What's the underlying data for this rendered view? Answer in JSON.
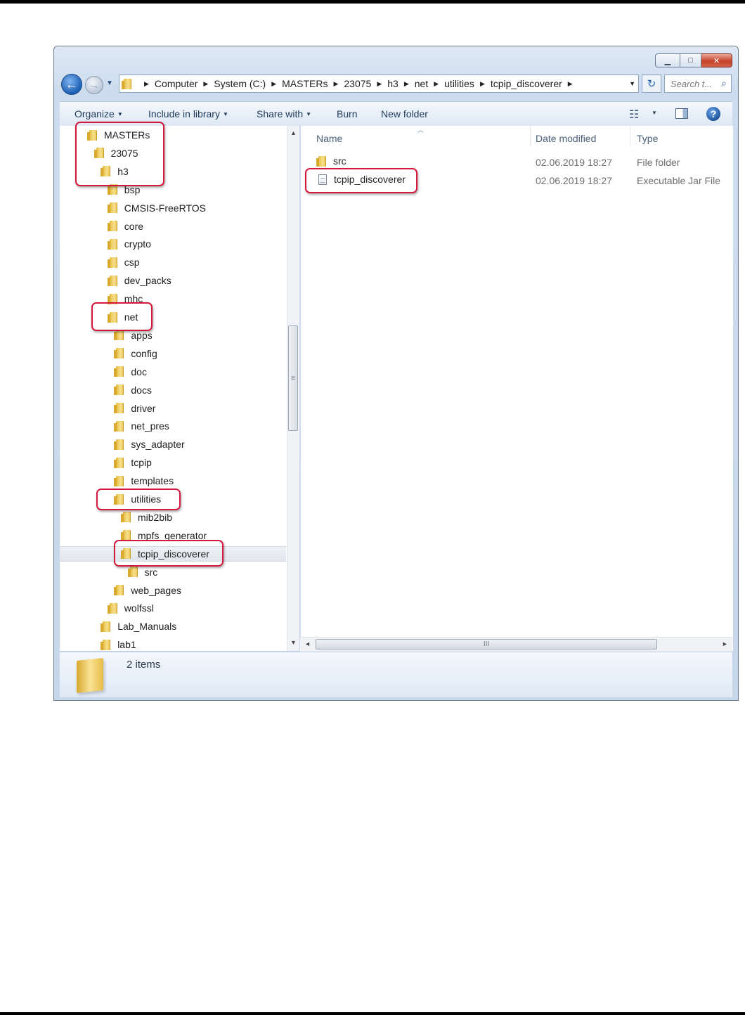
{
  "nav": {
    "back_glyph": "←",
    "forward_glyph": "→",
    "recent_glyph": "▼",
    "breadcrumbs": [
      "Computer",
      "System (C:)",
      "MASTERs",
      "23075",
      "h3",
      "net",
      "utilities",
      "tcpip_discoverer"
    ],
    "refresh_glyph": "↻",
    "search_placeholder": "Search t...",
    "search_icon": "⌕"
  },
  "window_controls": {
    "minimize": "▁",
    "maximize": "□",
    "close": "✕"
  },
  "toolbar": {
    "organize": "Organize",
    "include_in_library": "Include in library",
    "share_with": "Share with",
    "burn": "Burn",
    "new_folder": "New folder",
    "view_glyph": "☷",
    "help": "?"
  },
  "tree": [
    {
      "label": "MASTERs",
      "level": 0
    },
    {
      "label": "23075",
      "level": 1
    },
    {
      "label": "h3",
      "level": 2
    },
    {
      "label": "bsp",
      "level": 3
    },
    {
      "label": "CMSIS-FreeRTOS",
      "level": 3
    },
    {
      "label": "core",
      "level": 3
    },
    {
      "label": "crypto",
      "level": 3
    },
    {
      "label": "csp",
      "level": 3
    },
    {
      "label": "dev_packs",
      "level": 3
    },
    {
      "label": "mhc",
      "level": 3
    },
    {
      "label": "net",
      "level": 3
    },
    {
      "label": "apps",
      "level": 4
    },
    {
      "label": "config",
      "level": 4
    },
    {
      "label": "doc",
      "level": 4
    },
    {
      "label": "docs",
      "level": 4
    },
    {
      "label": "driver",
      "level": 4
    },
    {
      "label": "net_pres",
      "level": 4
    },
    {
      "label": "sys_adapter",
      "level": 4
    },
    {
      "label": "tcpip",
      "level": 4
    },
    {
      "label": "templates",
      "level": 4
    },
    {
      "label": "utilities",
      "level": 4
    },
    {
      "label": "mib2bib",
      "level": 5
    },
    {
      "label": "mpfs_generator",
      "level": 5
    },
    {
      "label": "tcpip_discoverer",
      "level": 5,
      "selected": true
    },
    {
      "label": "src",
      "level": 6
    },
    {
      "label": "web_pages",
      "level": 4
    },
    {
      "label": "wolfssl",
      "level": 3
    },
    {
      "label": "Lab_Manuals",
      "level": 2
    },
    {
      "label": "lab1",
      "level": 2
    }
  ],
  "columns": {
    "name": "Name",
    "date_modified": "Date modified",
    "type": "Type"
  },
  "files": [
    {
      "name": "src",
      "date": "02.06.2019 18:27",
      "type": "File folder",
      "icon": "folder-icon"
    },
    {
      "name": "tcpip_discoverer",
      "date": "02.06.2019 18:27",
      "type": "Executable Jar File",
      "icon": "jar-file-icon"
    }
  ],
  "status": {
    "item_count": "2 items"
  },
  "scroll": {
    "up": "▲",
    "down": "▼",
    "left": "◄",
    "right": "►",
    "grip_v": "≡",
    "grip_h": "III"
  },
  "colors": {
    "highlight": "#d5193e",
    "selection": "#e6eaef",
    "folder": "#f0c94a"
  }
}
